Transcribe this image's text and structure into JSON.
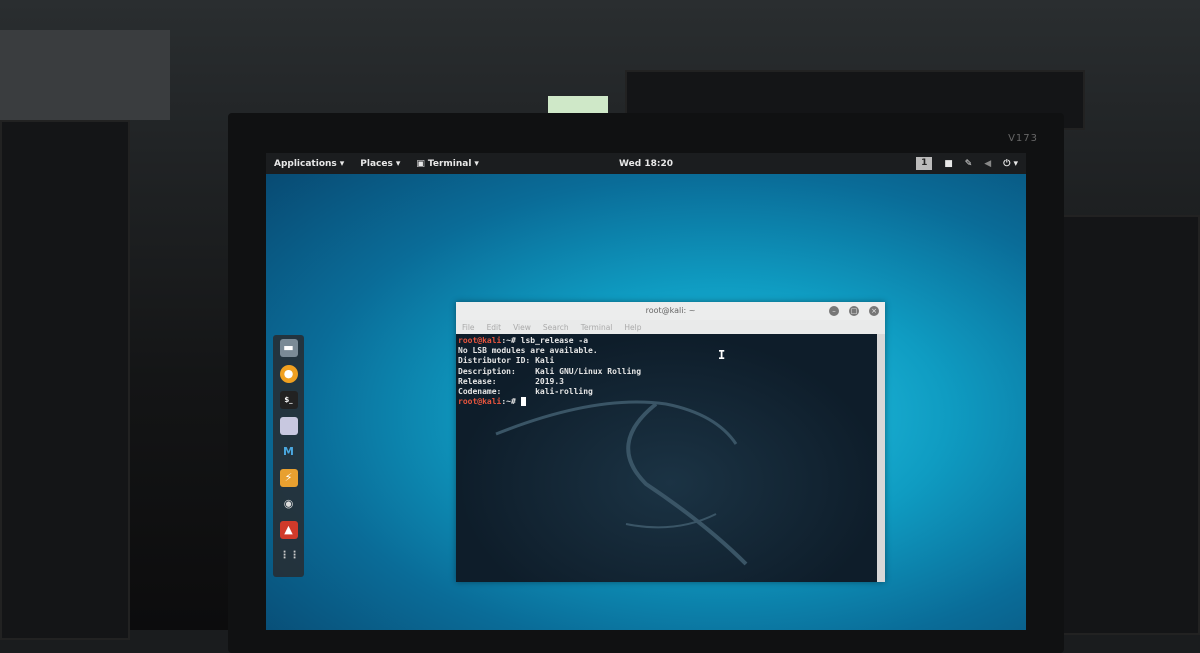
{
  "monitor": {
    "label": "V173"
  },
  "topbar": {
    "applications": "Applications",
    "places": "Places",
    "terminal": "Terminal",
    "clock": "Wed 18:20",
    "workspace": "1"
  },
  "dock": {
    "items": [
      "files",
      "firefox",
      "terminal",
      "notes",
      "metasploit",
      "burpsuite",
      "zenmap",
      "cherrytree",
      "show-apps"
    ]
  },
  "terminal": {
    "title": "root@kali: ~",
    "menu": [
      "File",
      "Edit",
      "View",
      "Search",
      "Terminal",
      "Help"
    ],
    "lines": [
      {
        "prompt": "root@kali",
        "suffix": ":~# ",
        "text": "lsb_release -a"
      },
      {
        "text": "No LSB modules are available."
      },
      {
        "text": "Distributor ID: Kali"
      },
      {
        "text": "Description:    Kali GNU/Linux Rolling"
      },
      {
        "text": "Release:        2019.3"
      },
      {
        "text": "Codename:       kali-rolling"
      },
      {
        "prompt": "root@kali",
        "suffix": ":~# ",
        "text": ""
      }
    ]
  }
}
